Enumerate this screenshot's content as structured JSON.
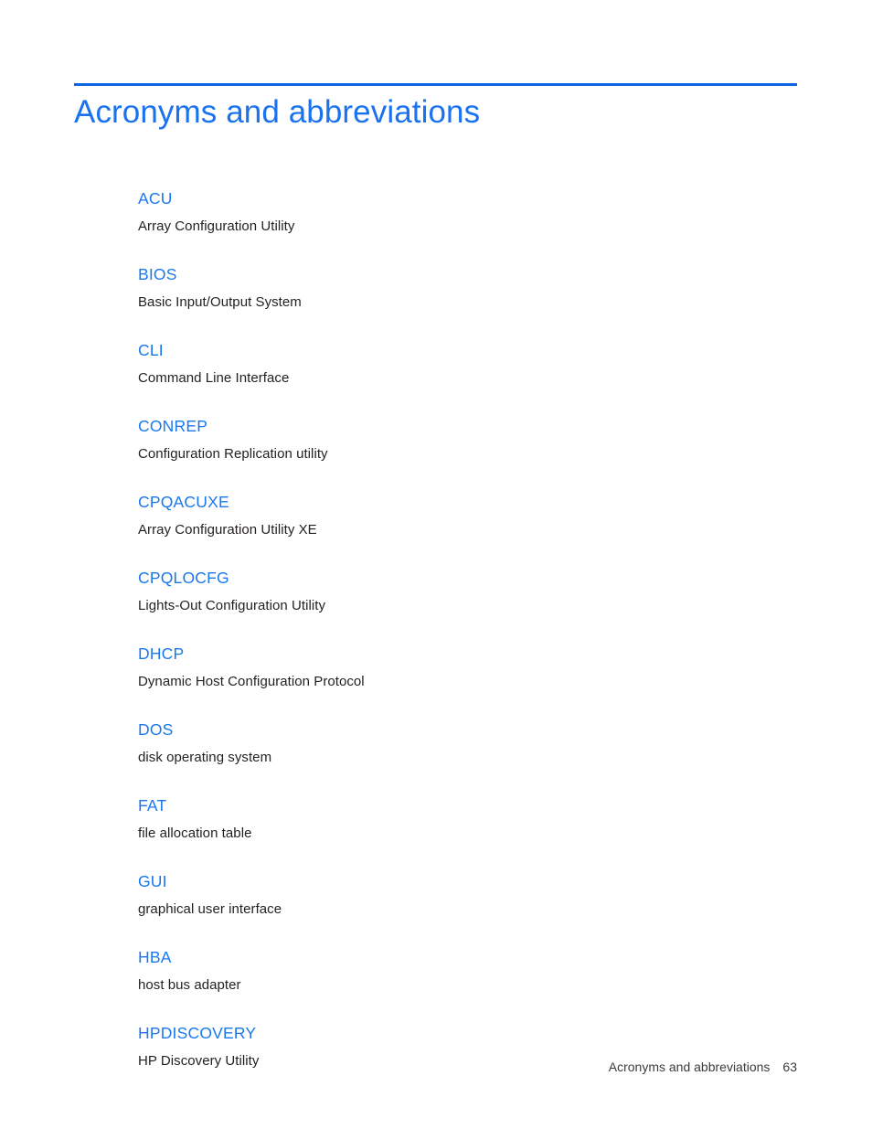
{
  "document": {
    "title": "Acronyms and abbreviations",
    "accent_color": "#0b66e8",
    "term_color": "#1a78ef",
    "body_color": "#231f20"
  },
  "glossary": {
    "entries": [
      {
        "term": "ACU",
        "definition": "Array Configuration Utility"
      },
      {
        "term": "BIOS",
        "definition": "Basic Input/Output System"
      },
      {
        "term": "CLI",
        "definition": "Command Line Interface"
      },
      {
        "term": "CONREP",
        "definition": "Configuration Replication utility"
      },
      {
        "term": "CPQACUXE",
        "definition": "Array Configuration Utility XE"
      },
      {
        "term": "CPQLOCFG",
        "definition": "Lights-Out Configuration Utility"
      },
      {
        "term": "DHCP",
        "definition": "Dynamic Host Configuration Protocol"
      },
      {
        "term": "DOS",
        "definition": "disk operating system"
      },
      {
        "term": "FAT",
        "definition": "file allocation table"
      },
      {
        "term": "GUI",
        "definition": "graphical user interface"
      },
      {
        "term": "HBA",
        "definition": "host bus adapter"
      },
      {
        "term": "HPDISCOVERY",
        "definition": "HP Discovery Utility"
      }
    ]
  },
  "footer": {
    "chapter": "Acronyms and abbreviations",
    "page_number": "63"
  }
}
